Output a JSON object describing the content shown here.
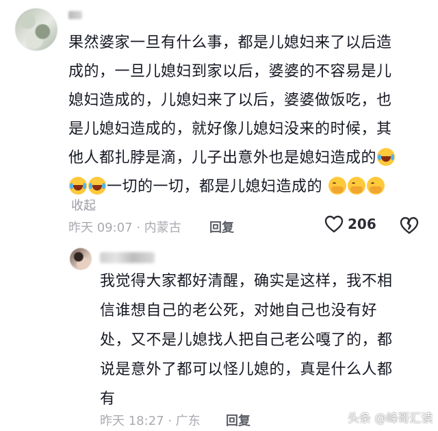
{
  "comment": {
    "lines": [
      "果然婆家一旦有什么事，都是儿媳妇来了以后造",
      "成的，一旦儿媳妇到家以后，婆婆的不容易是儿",
      "媳妇造成的，儿媳妇来了以后，婆婆做饭吃，也",
      "是儿媳妇造成的，就好像儿媳妇没来的时候，其",
      "他人都扎脖是滴，儿子出意外也是媳妇造成的"
    ],
    "last_line_text": "一切的一切，都是儿媳妇造成的",
    "emoji_laugh": "laughing-tears-emoji",
    "emoji_cover": "face-with-hand-over-mouth-emoji",
    "collapse_label": "收起",
    "time_location": "昨天 09:07 · 内蒙古",
    "reply_label": "回复",
    "like_count": "206"
  },
  "reply": {
    "lines": [
      "我觉得大家都好清醒，确实是这样，我不相",
      "信谁想自己的老公死，对她自己也没有好",
      "处，又不是儿媳找人把自己老公嘎了的，都",
      "说是意外了都可以怪儿媳的，真是什么人都",
      "有"
    ],
    "time_location": "昨天 18:27 · 广东",
    "reply_label": "回复"
  },
  "watermark": "头条 @峰哥汇读",
  "colors": {
    "text": "#161823",
    "meta": "#a9aab0",
    "reply_link": "#5b5d66"
  }
}
